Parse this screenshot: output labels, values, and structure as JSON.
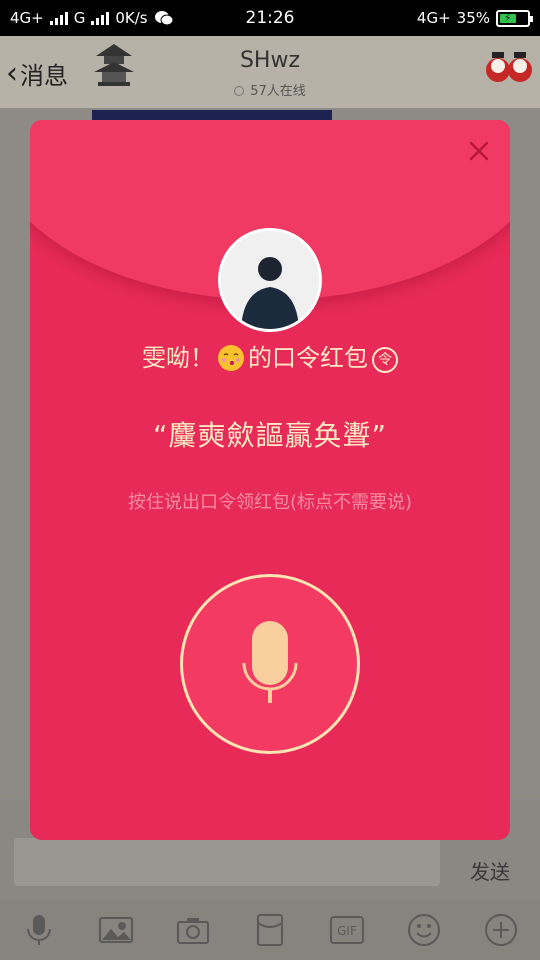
{
  "status_bar": {
    "network1": "4G+",
    "network2": "G",
    "speed": "0K/s",
    "time": "21:26",
    "network3": "4G+",
    "battery": "35%"
  },
  "chat": {
    "back_label": "消息",
    "title": "SHwz",
    "online": "57人在线",
    "send_label": "发送"
  },
  "red_packet": {
    "title_prefix": "雯呦！",
    "title_suffix": "的口令红包",
    "badge": "令",
    "password": "“麜奭歛謳贏奂聻”",
    "hint": "按住说出口令领红包(标点不需要说)"
  },
  "toolbar": {
    "icons": [
      "microphone-icon",
      "image-icon",
      "camera-icon",
      "red-packet-icon",
      "gif-icon",
      "emoji-icon",
      "plus-icon"
    ],
    "gif_label": "GIF"
  },
  "colors": {
    "modal": "#e72a57",
    "flap": "#f13a63",
    "cream_text": "#ffe9c4",
    "hint_text": "#f68aa2",
    "mic": "#f9cf9e"
  }
}
